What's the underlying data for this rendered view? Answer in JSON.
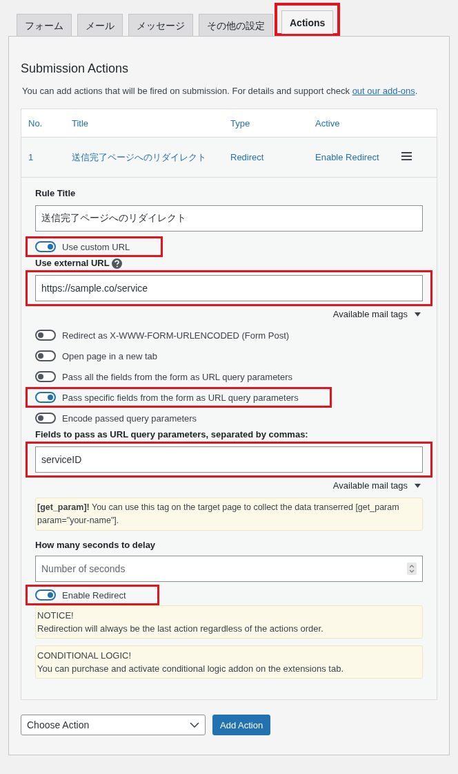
{
  "tabs": [
    {
      "label": "フォーム",
      "selected": false,
      "highlighted": false
    },
    {
      "label": "メール",
      "selected": false,
      "highlighted": false
    },
    {
      "label": "メッセージ",
      "selected": false,
      "highlighted": false
    },
    {
      "label": "その他の設定",
      "selected": false,
      "highlighted": false
    },
    {
      "label": "Actions",
      "selected": true,
      "highlighted": true
    }
  ],
  "section": {
    "title": "Submission Actions",
    "description": "You can add actions that will be fired on submission. For details and support check ",
    "link": "out our add-ons",
    "description_end": "."
  },
  "table": {
    "columns": [
      "No.",
      "Title",
      "Type",
      "Active"
    ],
    "rows": [
      {
        "no": "1",
        "title": "送信完了ページへのリダイレクト",
        "type": "Redirect",
        "active": "Enable Redirect"
      }
    ]
  },
  "editor": {
    "items": [
      {
        "kind": "field",
        "label": "Rule Title",
        "help": false,
        "value": "送信完了ページへのリダイレクト",
        "highlighted": false
      },
      {
        "kind": "toggle",
        "label": "Use custom URL",
        "on": true,
        "highlighted": true
      },
      {
        "kind": "field",
        "label": "Use external URL",
        "help": true,
        "value": "https://sample.co/service",
        "highlighted": true
      },
      {
        "kind": "tags",
        "label": "Available mail tags"
      },
      {
        "kind": "toggle",
        "label": "Redirect as X-WWW-FORM-URLENCODED (Form Post)",
        "on": false,
        "highlighted": false
      },
      {
        "kind": "toggle",
        "label": "Open page in a new tab",
        "on": false,
        "highlighted": false
      },
      {
        "kind": "toggle",
        "label": "Pass all the fields from the form as URL query parameters",
        "on": false,
        "highlighted": false
      },
      {
        "kind": "toggle",
        "label": "Pass specific fields from the form as URL query parameters",
        "on": true,
        "highlighted": true
      },
      {
        "kind": "toggle",
        "label": "Encode passed query parameters",
        "on": false,
        "highlighted": false
      },
      {
        "kind": "field",
        "label": "Fields to pass as URL query parameters, separated by commas:",
        "help": false,
        "value": "serviceID",
        "highlighted": true
      },
      {
        "kind": "tags",
        "label": "Available mail tags"
      },
      {
        "kind": "note",
        "text": "**[get_param]!** You can use this tag on the target page to collect the data transerred [get_param param=\"your-name\"]."
      },
      {
        "kind": "number",
        "label": "How many seconds to delay",
        "placeholder": "Number of seconds"
      },
      {
        "kind": "toggle",
        "label": "Enable Redirect",
        "on": true,
        "highlighted": true
      },
      {
        "kind": "notice",
        "title": "NOTICE!",
        "text": "Redirection will always be the last action regardless of the actions order."
      },
      {
        "kind": "notice",
        "title": "CONDITIONAL LOGIC!",
        "text": "You can purchase and activate conditional logic addon on the extensions tab."
      }
    ]
  },
  "footer": {
    "select": "Choose Action",
    "button": "Add Action"
  }
}
